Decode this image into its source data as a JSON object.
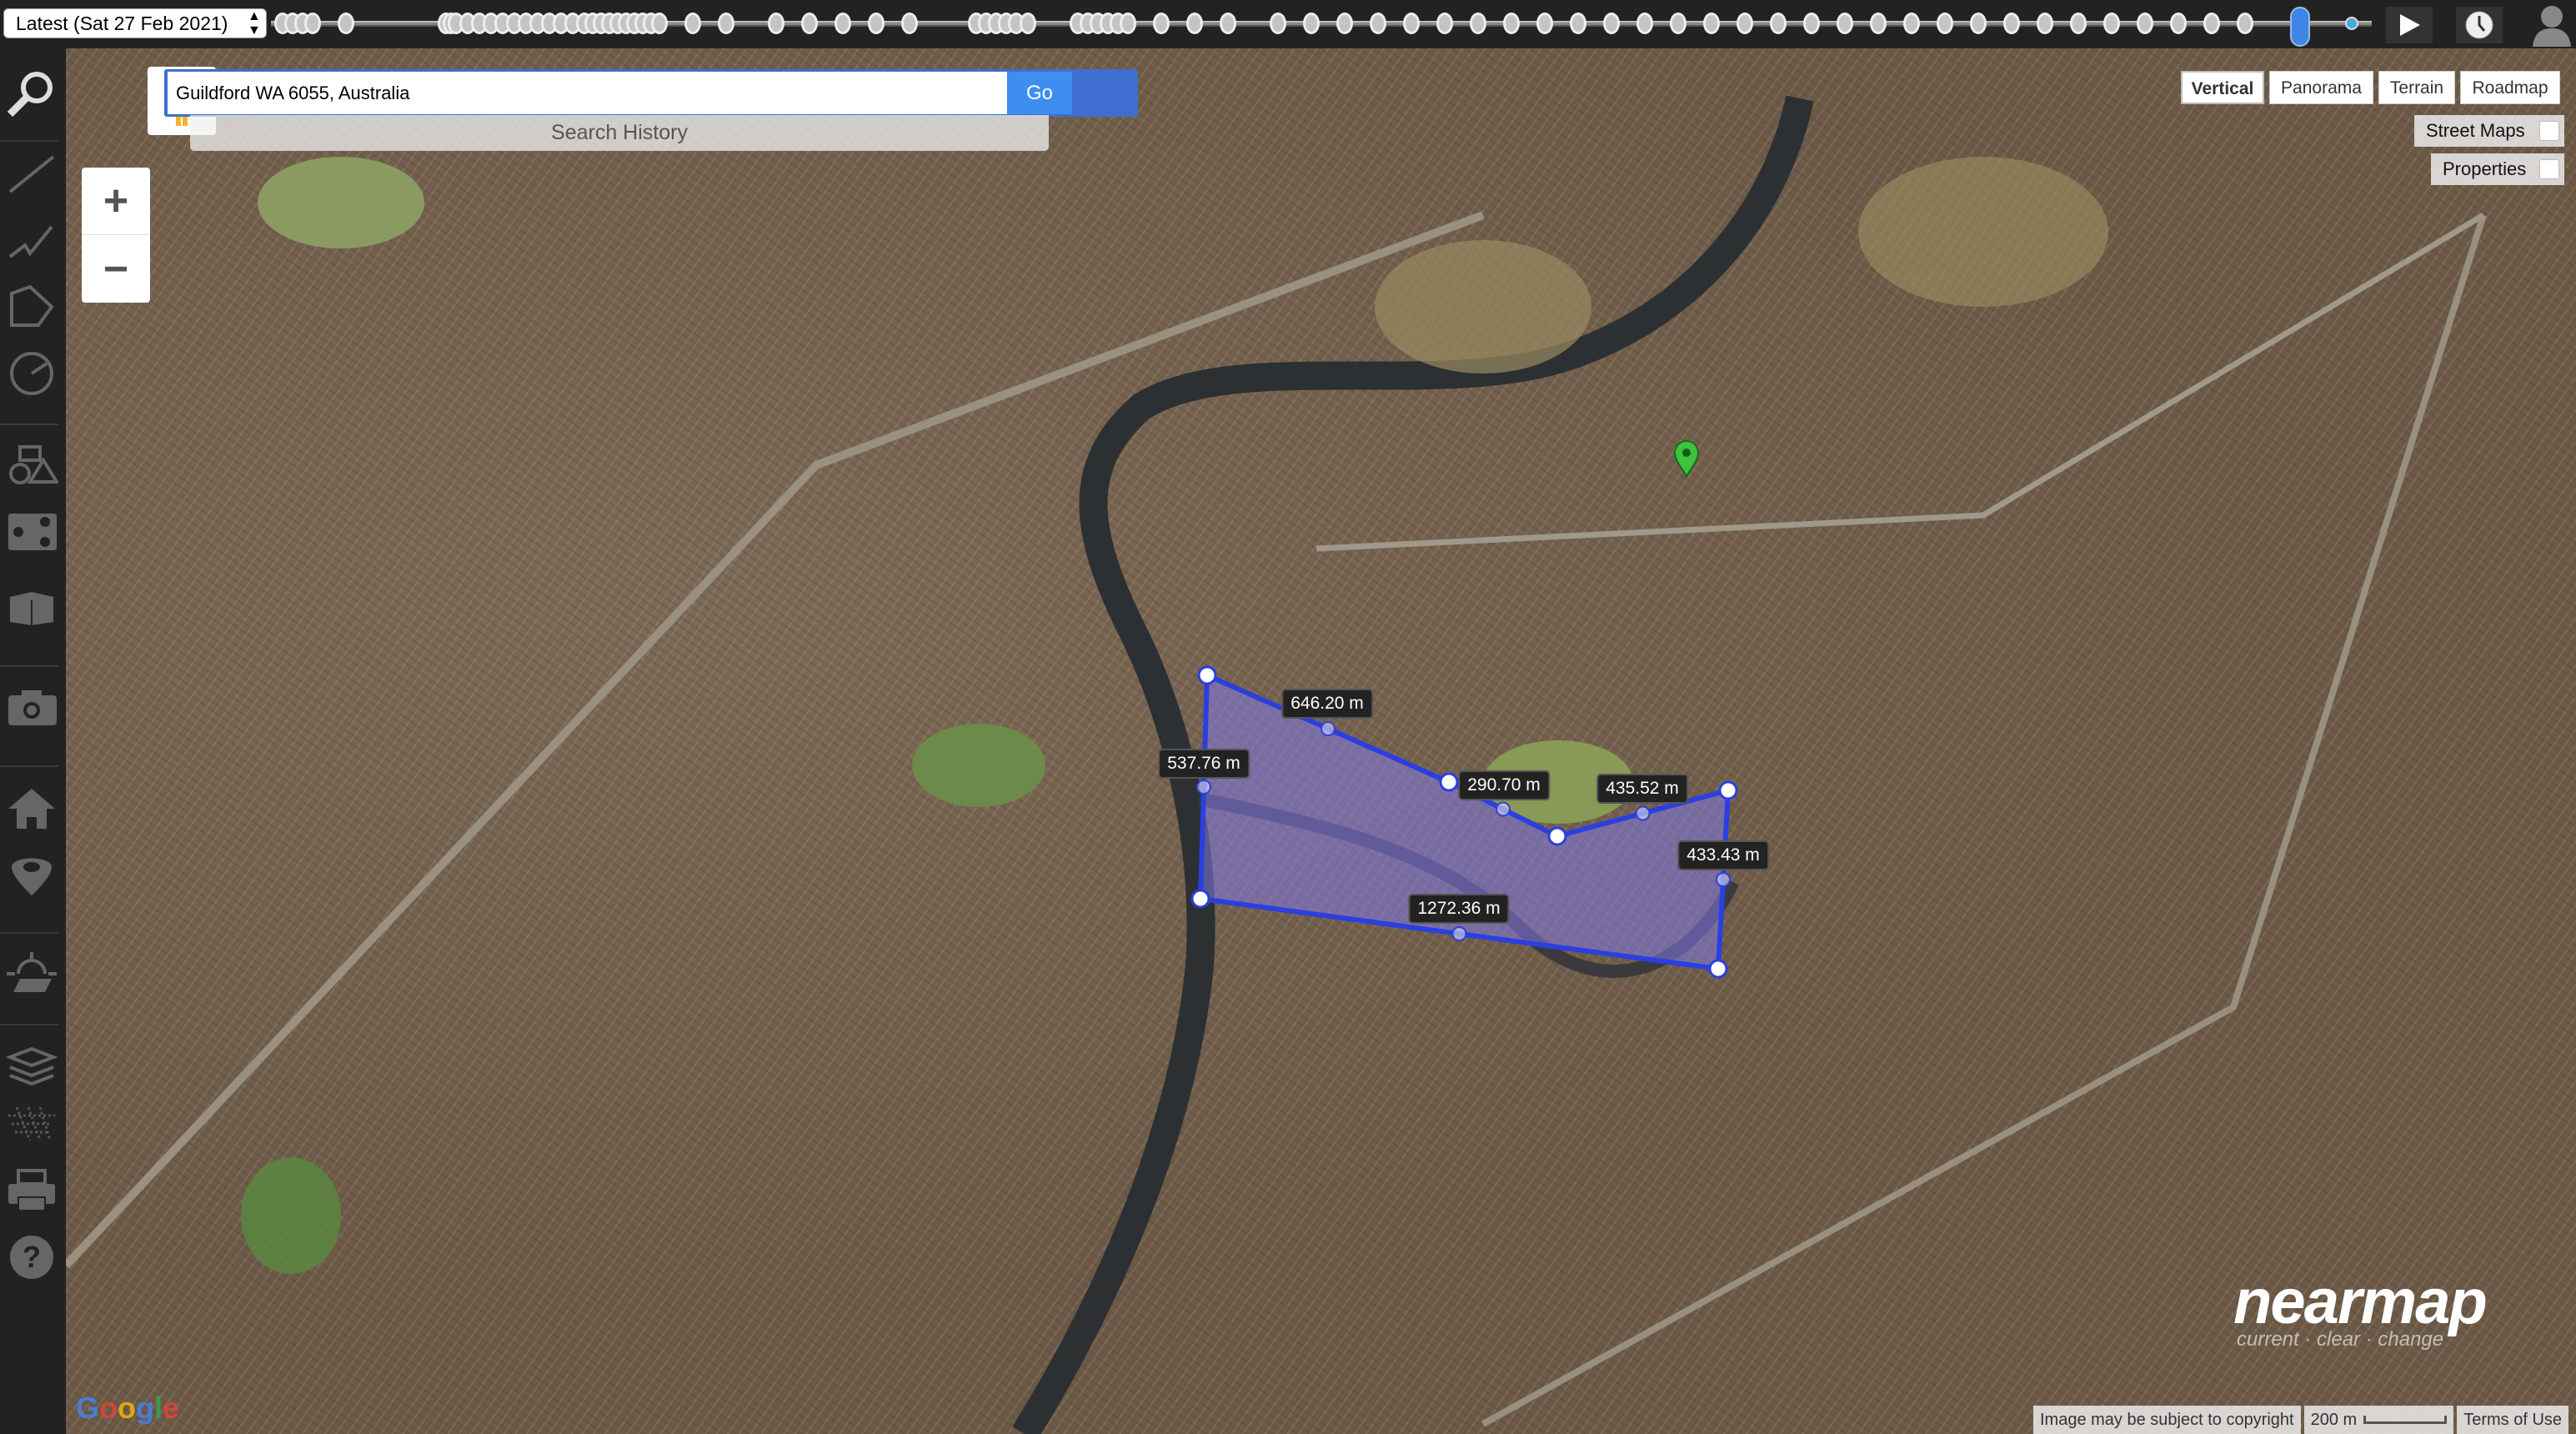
{
  "timeline": {
    "selected_date": "Latest (Sat 27 Feb 2021)",
    "play_icon": "play-icon",
    "history_icon": "clock-icon",
    "user_icon": "user-icon"
  },
  "sidebar": {
    "tools": [
      "search-icon",
      "line-measure-icon",
      "polyline-icon",
      "polygon-icon",
      "radius-icon",
      "shapes-icon",
      "share-icon",
      "3d-box-icon",
      "camera-icon",
      "home-icon",
      "location-pin-icon",
      "sun-solar-icon",
      "layers-icon",
      "grid-icon",
      "print-icon",
      "help-icon"
    ]
  },
  "search": {
    "value": "Guildford WA 6055, Australia",
    "go_label": "Go",
    "history_label": "Search History"
  },
  "zoom": {
    "in_label": "+",
    "out_label": "−"
  },
  "map_types": [
    {
      "label": "Vertical",
      "active": true
    },
    {
      "label": "Panorama",
      "active": false
    },
    {
      "label": "Terrain",
      "active": false
    },
    {
      "label": "Roadmap",
      "active": false
    }
  ],
  "overlays": [
    {
      "label": "Street Maps",
      "checked": false
    },
    {
      "label": "Properties",
      "checked": false
    }
  ],
  "measurement": {
    "color": "#2b3fe0",
    "fill": "rgba(130,120,230,0.55)",
    "segments": [
      "646.20 m",
      "290.70 m",
      "435.52 m",
      "433.43 m",
      "1272.36 m",
      "537.76 m"
    ]
  },
  "logos": {
    "nearmap": "nearmap",
    "nearmap_tagline": "current · clear · change",
    "google": "Google"
  },
  "footer": {
    "copyright": "Image may be subject to copyright",
    "scale": "200 m",
    "terms": "Terms of Use"
  }
}
